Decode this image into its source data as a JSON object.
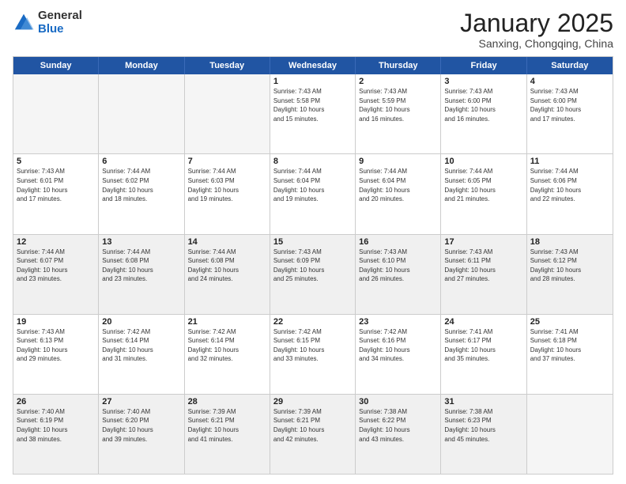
{
  "logo": {
    "general": "General",
    "blue": "Blue"
  },
  "title": {
    "month": "January 2025",
    "location": "Sanxing, Chongqing, China"
  },
  "headers": [
    "Sunday",
    "Monday",
    "Tuesday",
    "Wednesday",
    "Thursday",
    "Friday",
    "Saturday"
  ],
  "weeks": [
    [
      {
        "day": "",
        "info": "",
        "empty": true
      },
      {
        "day": "",
        "info": "",
        "empty": true
      },
      {
        "day": "",
        "info": "",
        "empty": true
      },
      {
        "day": "1",
        "info": "Sunrise: 7:43 AM\nSunset: 5:58 PM\nDaylight: 10 hours\nand 15 minutes.",
        "empty": false
      },
      {
        "day": "2",
        "info": "Sunrise: 7:43 AM\nSunset: 5:59 PM\nDaylight: 10 hours\nand 16 minutes.",
        "empty": false
      },
      {
        "day": "3",
        "info": "Sunrise: 7:43 AM\nSunset: 6:00 PM\nDaylight: 10 hours\nand 16 minutes.",
        "empty": false
      },
      {
        "day": "4",
        "info": "Sunrise: 7:43 AM\nSunset: 6:00 PM\nDaylight: 10 hours\nand 17 minutes.",
        "empty": false
      }
    ],
    [
      {
        "day": "5",
        "info": "Sunrise: 7:43 AM\nSunset: 6:01 PM\nDaylight: 10 hours\nand 17 minutes.",
        "empty": false
      },
      {
        "day": "6",
        "info": "Sunrise: 7:44 AM\nSunset: 6:02 PM\nDaylight: 10 hours\nand 18 minutes.",
        "empty": false
      },
      {
        "day": "7",
        "info": "Sunrise: 7:44 AM\nSunset: 6:03 PM\nDaylight: 10 hours\nand 19 minutes.",
        "empty": false
      },
      {
        "day": "8",
        "info": "Sunrise: 7:44 AM\nSunset: 6:04 PM\nDaylight: 10 hours\nand 19 minutes.",
        "empty": false
      },
      {
        "day": "9",
        "info": "Sunrise: 7:44 AM\nSunset: 6:04 PM\nDaylight: 10 hours\nand 20 minutes.",
        "empty": false
      },
      {
        "day": "10",
        "info": "Sunrise: 7:44 AM\nSunset: 6:05 PM\nDaylight: 10 hours\nand 21 minutes.",
        "empty": false
      },
      {
        "day": "11",
        "info": "Sunrise: 7:44 AM\nSunset: 6:06 PM\nDaylight: 10 hours\nand 22 minutes.",
        "empty": false
      }
    ],
    [
      {
        "day": "12",
        "info": "Sunrise: 7:44 AM\nSunset: 6:07 PM\nDaylight: 10 hours\nand 23 minutes.",
        "empty": false,
        "shaded": true
      },
      {
        "day": "13",
        "info": "Sunrise: 7:44 AM\nSunset: 6:08 PM\nDaylight: 10 hours\nand 23 minutes.",
        "empty": false,
        "shaded": true
      },
      {
        "day": "14",
        "info": "Sunrise: 7:44 AM\nSunset: 6:08 PM\nDaylight: 10 hours\nand 24 minutes.",
        "empty": false,
        "shaded": true
      },
      {
        "day": "15",
        "info": "Sunrise: 7:43 AM\nSunset: 6:09 PM\nDaylight: 10 hours\nand 25 minutes.",
        "empty": false,
        "shaded": true
      },
      {
        "day": "16",
        "info": "Sunrise: 7:43 AM\nSunset: 6:10 PM\nDaylight: 10 hours\nand 26 minutes.",
        "empty": false,
        "shaded": true
      },
      {
        "day": "17",
        "info": "Sunrise: 7:43 AM\nSunset: 6:11 PM\nDaylight: 10 hours\nand 27 minutes.",
        "empty": false,
        "shaded": true
      },
      {
        "day": "18",
        "info": "Sunrise: 7:43 AM\nSunset: 6:12 PM\nDaylight: 10 hours\nand 28 minutes.",
        "empty": false,
        "shaded": true
      }
    ],
    [
      {
        "day": "19",
        "info": "Sunrise: 7:43 AM\nSunset: 6:13 PM\nDaylight: 10 hours\nand 29 minutes.",
        "empty": false
      },
      {
        "day": "20",
        "info": "Sunrise: 7:42 AM\nSunset: 6:14 PM\nDaylight: 10 hours\nand 31 minutes.",
        "empty": false
      },
      {
        "day": "21",
        "info": "Sunrise: 7:42 AM\nSunset: 6:14 PM\nDaylight: 10 hours\nand 32 minutes.",
        "empty": false
      },
      {
        "day": "22",
        "info": "Sunrise: 7:42 AM\nSunset: 6:15 PM\nDaylight: 10 hours\nand 33 minutes.",
        "empty": false
      },
      {
        "day": "23",
        "info": "Sunrise: 7:42 AM\nSunset: 6:16 PM\nDaylight: 10 hours\nand 34 minutes.",
        "empty": false
      },
      {
        "day": "24",
        "info": "Sunrise: 7:41 AM\nSunset: 6:17 PM\nDaylight: 10 hours\nand 35 minutes.",
        "empty": false
      },
      {
        "day": "25",
        "info": "Sunrise: 7:41 AM\nSunset: 6:18 PM\nDaylight: 10 hours\nand 37 minutes.",
        "empty": false
      }
    ],
    [
      {
        "day": "26",
        "info": "Sunrise: 7:40 AM\nSunset: 6:19 PM\nDaylight: 10 hours\nand 38 minutes.",
        "empty": false,
        "shaded": true
      },
      {
        "day": "27",
        "info": "Sunrise: 7:40 AM\nSunset: 6:20 PM\nDaylight: 10 hours\nand 39 minutes.",
        "empty": false,
        "shaded": true
      },
      {
        "day": "28",
        "info": "Sunrise: 7:39 AM\nSunset: 6:21 PM\nDaylight: 10 hours\nand 41 minutes.",
        "empty": false,
        "shaded": true
      },
      {
        "day": "29",
        "info": "Sunrise: 7:39 AM\nSunset: 6:21 PM\nDaylight: 10 hours\nand 42 minutes.",
        "empty": false,
        "shaded": true
      },
      {
        "day": "30",
        "info": "Sunrise: 7:38 AM\nSunset: 6:22 PM\nDaylight: 10 hours\nand 43 minutes.",
        "empty": false,
        "shaded": true
      },
      {
        "day": "31",
        "info": "Sunrise: 7:38 AM\nSunset: 6:23 PM\nDaylight: 10 hours\nand 45 minutes.",
        "empty": false,
        "shaded": true
      },
      {
        "day": "",
        "info": "",
        "empty": true,
        "shaded": true
      }
    ]
  ]
}
